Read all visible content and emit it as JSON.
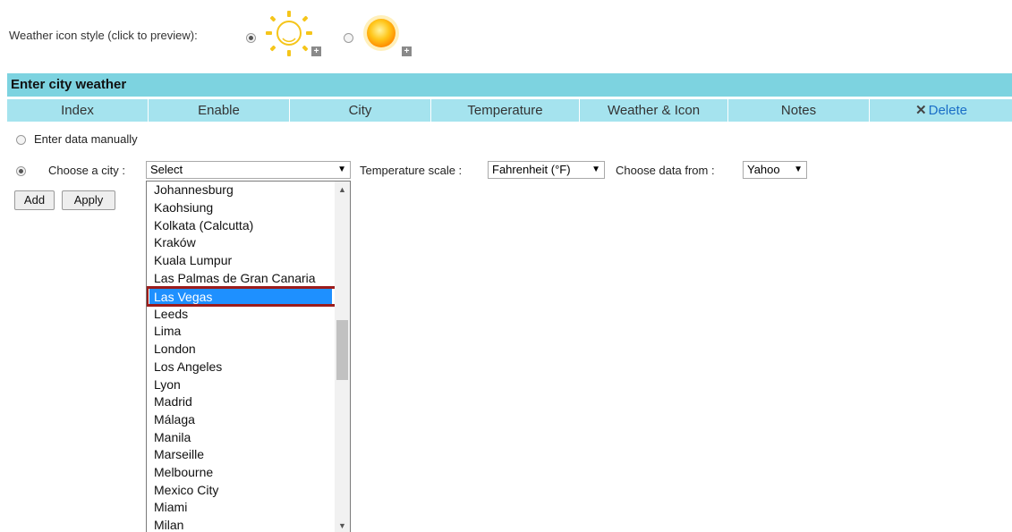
{
  "icon_style": {
    "label": "Weather icon style (click to preview):",
    "options": [
      {
        "name": "outline-sun",
        "selected": true
      },
      {
        "name": "glossy-sun",
        "selected": false
      }
    ]
  },
  "section": {
    "title": "Enter city weather"
  },
  "table_columns": [
    "Index",
    "Enable",
    "City",
    "Temperature",
    "Weather & Icon",
    "Notes",
    "Delete"
  ],
  "manual": {
    "label": "Enter data manually",
    "selected": false
  },
  "city_choice": {
    "label": "Choose a city :",
    "selected": true,
    "select_value": "Select",
    "temp_label": "Temperature scale :",
    "temp_value": "Fahrenheit (°F)",
    "source_label": "Choose data from :",
    "source_value": "Yahoo"
  },
  "buttons": {
    "add": "Add",
    "apply": "Apply"
  },
  "city_options": [
    "Johannesburg",
    "Kaohsiung",
    "Kolkata (Calcutta)",
    "Kraków",
    "Kuala Lumpur",
    "Las Palmas de Gran Canaria",
    "Las Vegas",
    "Leeds",
    "Lima",
    "London",
    "Los Angeles",
    "Lyon",
    "Madrid",
    "Málaga",
    "Manila",
    "Marseille",
    "Melbourne",
    "Mexico City",
    "Miami",
    "Milan"
  ],
  "highlighted_option": "Las Vegas",
  "colors": {
    "header": "#7dd3e0",
    "subheader": "#a5e3ee",
    "highlight": "#1e90ff",
    "outline": "#9b1c1c",
    "link": "#1a6ec7"
  }
}
